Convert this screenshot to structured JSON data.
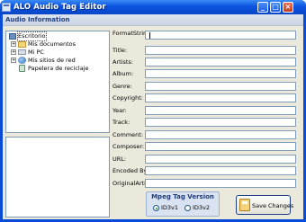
{
  "window": {
    "title": "ALO Audio Tag Editor"
  },
  "group": {
    "title": "Audio Information"
  },
  "tree": {
    "items": [
      {
        "label": "Escritorio"
      },
      {
        "label": "Mis documentos"
      },
      {
        "label": "Mi PC"
      },
      {
        "label": "Mis sitios de red"
      },
      {
        "label": "Papelera de reciclaje"
      }
    ]
  },
  "fields": [
    {
      "label": "FormatString:",
      "value": ""
    },
    {
      "label": "Title:",
      "value": ""
    },
    {
      "label": "Artists:",
      "value": ""
    },
    {
      "label": "Album:",
      "value": ""
    },
    {
      "label": "Genre:",
      "value": ""
    },
    {
      "label": "Copyright:",
      "value": ""
    },
    {
      "label": "Year:",
      "value": ""
    },
    {
      "label": "Track:",
      "value": ""
    },
    {
      "label": "Comment:",
      "value": ""
    },
    {
      "label": "Composer:",
      "value": ""
    },
    {
      "label": "URL:",
      "value": ""
    },
    {
      "label": "Encoded By:",
      "value": ""
    },
    {
      "label": "OriginalArtist:",
      "value": ""
    }
  ],
  "mpeg": {
    "title": "Mpeg Tag Version",
    "options": [
      {
        "label": "ID3v1",
        "selected": true
      },
      {
        "label": "ID3v2",
        "selected": false
      }
    ]
  },
  "save_button": {
    "label": "Save Changes"
  }
}
